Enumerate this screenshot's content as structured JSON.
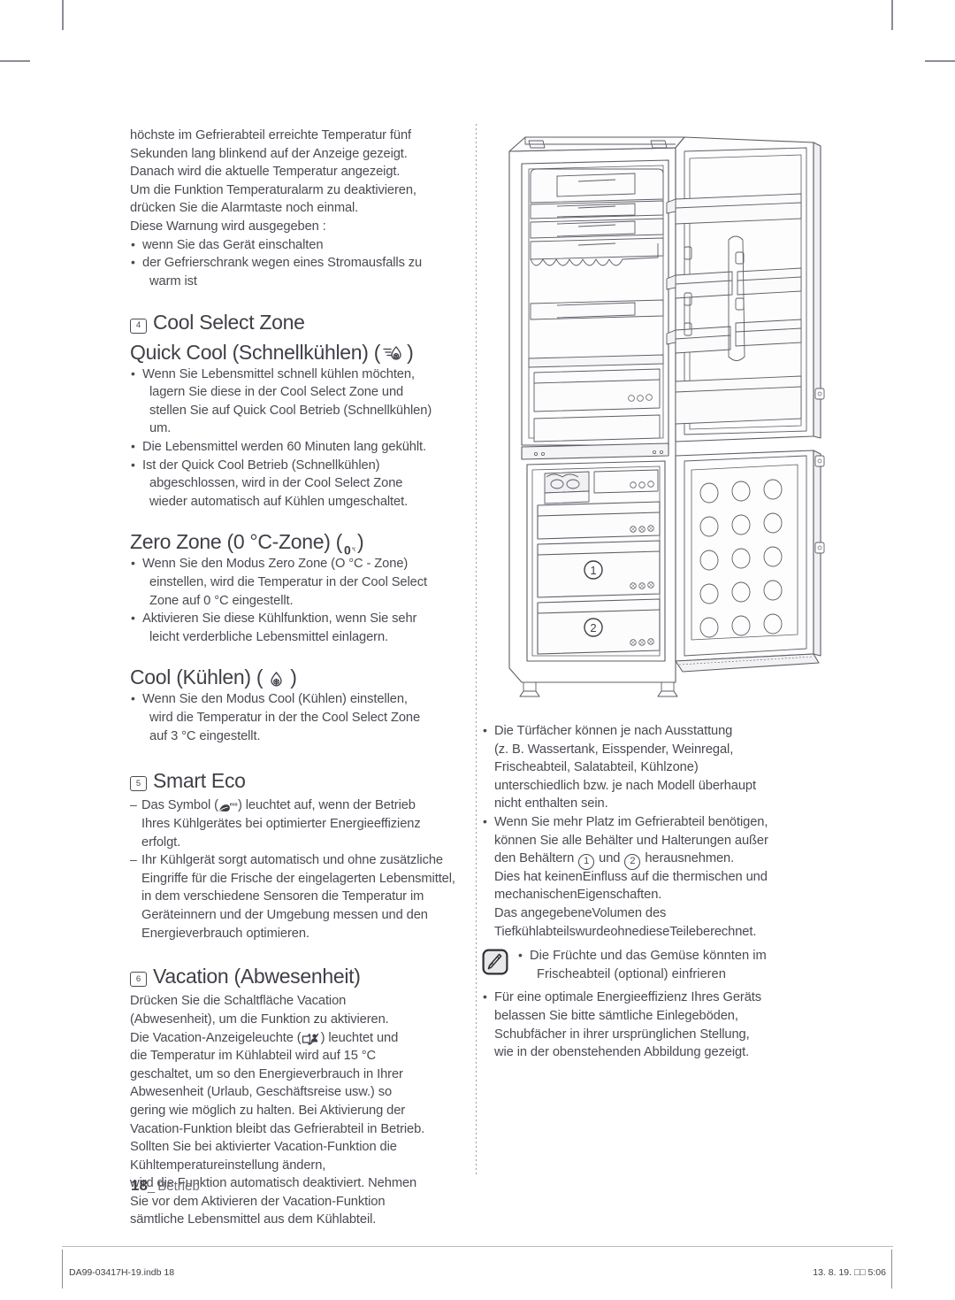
{
  "document": {
    "language": "de",
    "page_number": "18",
    "page_section": "Betrieb",
    "footer_left": "DA99-03417H-19.indb   18",
    "footer_right": "13. 8. 19.   □□ 5:06"
  },
  "left_column": {
    "intro_paragraph": {
      "lines": [
        "höchste im Gefrierabteil erreichte Temperatur fünf",
        "Sekunden lang blinkend auf der Anzeige gezeigt.",
        "Danach wird die aktuelle Temperatur angezeigt.",
        "Um die Funktion Temperaturalarm zu deaktivieren,",
        "drücken Sie die Alarmtaste noch einmal.",
        "Diese Warnung wird ausgegeben :"
      ]
    },
    "intro_bullets": [
      {
        "lines": [
          "wenn Sie das Gerät einschalten"
        ]
      },
      {
        "lines": [
          "der Gefrierschrank wegen eines Stromausfalls zu",
          "warm ist"
        ]
      }
    ],
    "section_cool_select": {
      "number": "4",
      "title": "Cool Select Zone",
      "quick_cool": {
        "heading_text": "Quick Cool (Schnellkühlen) (",
        "heading_close": ")",
        "icon": "quick-cool-icon",
        "bullets": [
          {
            "lines": [
              "Wenn Sie Lebensmittel schnell kühlen möchten,",
              "lagern Sie diese in der Cool Select Zone und",
              "stellen Sie auf Quick Cool Betrieb (Schnellkühlen)",
              "um."
            ]
          },
          {
            "lines": [
              "Die Lebensmittel werden 60 Minuten lang gekühlt."
            ]
          },
          {
            "lines": [
              "Ist der Quick Cool Betrieb (Schnellkühlen)",
              "abgeschlossen, wird in der Cool Select Zone",
              "wieder automatisch auf Kühlen umgeschaltet."
            ]
          }
        ]
      },
      "zero_zone": {
        "heading_text": "Zero Zone (0 °C-Zone) (",
        "heading_close": ")",
        "icon": "zero-degree-icon",
        "bullets": [
          {
            "lines": [
              "Wenn Sie den Modus Zero Zone (O °C - Zone)",
              "einstellen, wird die Temperatur in der Cool Select",
              "Zone auf 0 °C eingestellt."
            ]
          },
          {
            "lines": [
              "Aktivieren Sie diese Kühlfunktion, wenn Sie sehr",
              "leicht verderbliche Lebensmittel einlagern."
            ]
          }
        ]
      },
      "cool": {
        "heading_text": "Cool (Kühlen) (",
        "heading_close": ")",
        "icon": "cool-drop-icon",
        "bullets": [
          {
            "lines": [
              "Wenn Sie den Modus Cool (Kühlen) einstellen,",
              "wird die Temperatur in der the Cool Select Zone",
              "auf 3 °C eingestellt."
            ]
          }
        ]
      }
    },
    "section_smart_eco": {
      "number": "5",
      "title": "Smart Eco",
      "items": [
        {
          "prefix": "Das Symbol (",
          "icon": "eco-leaf-icon",
          "lines": [
            ") leuchtet auf, wenn der Betrieb",
            "Ihres Kühlgerätes bei optimierter Energieeffizienz",
            "erfolgt."
          ]
        },
        {
          "lines": [
            "Ihr Kühlgerät sorgt automatisch und ohne zusätzliche",
            "Eingriffe für die Frische der eingelagerten Lebensmittel,",
            "in dem verschiedene Sensoren die Temperatur im",
            "Geräteinnern und der Umgebung messen und den",
            "Energieverbrauch optimieren."
          ]
        }
      ]
    },
    "section_vacation": {
      "number": "6",
      "title": "Vacation (Abwesenheit)",
      "icon": "vacation-icon",
      "paragraph_lines_a": [
        "Drücken Sie die Schaltfläche Vacation",
        "(Abwesenheit), um die Funktion zu aktivieren.",
        "Die Vacation-Anzeigeleuchte ("
      ],
      "paragraph_lines_b": [
        ") leuchtet und",
        "die Temperatur im Kühlabteil wird auf 15 °C",
        "geschaltet, um so den Energieverbrauch in Ihrer",
        "Abwesenheit (Urlaub, Geschäftsreise usw.) so",
        "gering wie möglich zu halten. Bei Aktivierung der",
        "Vacation-Funktion bleibt das Gefrierabteil in Betrieb.",
        "Sollten Sie bei aktivierter Vacation-Funktion die",
        "Kühltemperatureinstellung ändern,",
        "wird die Funktion automatisch deaktiviert. Nehmen",
        "Sie vor dem Aktivieren der Vacation-Funktion",
        "sämtliche Lebensmittel aus dem Kühlabteil."
      ]
    }
  },
  "right_column": {
    "bullets": [
      {
        "lines": [
          "Die Türfächer können je nach Ausstattung",
          "(z. B. Wassertank, Eisspender, Weinregal,",
          "Frischeabteil, Salatabteil, Kühlzone)",
          "unterschiedlich bzw. je nach Modell überhaupt",
          "nicht enthalten sein."
        ]
      }
    ],
    "bullet_containers": {
      "line1": "Wenn Sie mehr Platz im Gefrierabteil benötigen,",
      "line2": "können Sie alle Behälter und Halterungen außer",
      "line3_a": "den Behältern",
      "num1": "1",
      "line3_b": "und",
      "num2": "2",
      "line3_c": "herausnehmen.",
      "line4": "Dies hat keinenEinfluss auf die thermischen und",
      "line5": "mechanischenEigenschaften.",
      "line6": "Das angegebeneVolumen des",
      "line7": "TiefkühlabteilswurdeohnedieseTeileberechnet."
    },
    "note": {
      "icon": "note-pen-icon",
      "lines": [
        "Die Früchte und das Gemüse könnten im",
        "Frischeabteil (optional) einfrieren"
      ]
    },
    "final_bullet": {
      "lines": [
        "Für eine optimale Energieeffizienz Ihres Geräts",
        "belassen Sie bitte sämtliche Einlegeböden,",
        "Schubfächer in ihrer ursprünglichen Stellung,",
        "wie in der obenstehenden Abbildung gezeigt."
      ]
    }
  },
  "illustration": {
    "name": "refrigerator-line-drawing",
    "callouts": [
      {
        "label": "1",
        "meaning": "freezer-drawer-1"
      },
      {
        "label": "2",
        "meaning": "freezer-drawer-2"
      }
    ]
  },
  "colors": {
    "text": "#4a4a52",
    "heading": "#3f3f47",
    "line": "#6b6b75",
    "rule": "#b9b9c1"
  }
}
